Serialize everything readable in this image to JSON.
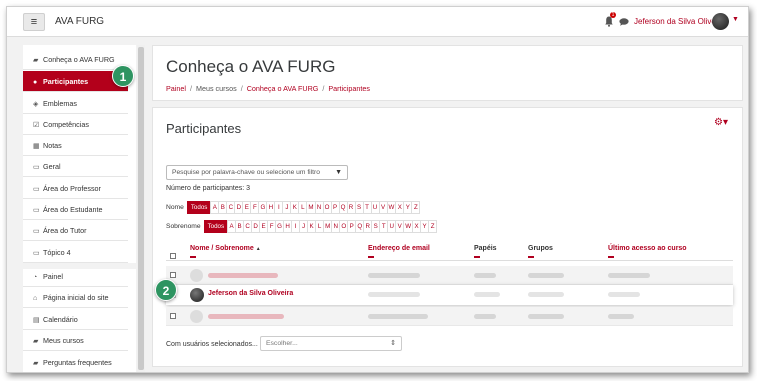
{
  "navbar": {
    "menu_icon": "hamburger-icon",
    "brand": "AVA FURG",
    "notification_icon": "bell-icon",
    "notification_count": "1",
    "messages_icon": "chat-icon",
    "user_name": "Jeferson da Silva Oliveira",
    "user_menu_icon": "caret-down-icon"
  },
  "sidebar": {
    "items": [
      {
        "label": "Conheça o AVA FURG",
        "icon": "graduation-cap-icon",
        "glyph": "🎓"
      },
      {
        "label": "Participantes",
        "icon": "users-icon",
        "glyph": "👥"
      },
      {
        "label": "Emblemas",
        "icon": "shield-icon",
        "glyph": "🛡"
      },
      {
        "label": "Competências",
        "icon": "checkbox-icon",
        "glyph": "☑"
      },
      {
        "label": "Notas",
        "icon": "table-icon",
        "glyph": "▦"
      },
      {
        "label": "Geral",
        "icon": "folder-icon",
        "glyph": "▢"
      },
      {
        "label": "Área do Professor",
        "icon": "folder-icon",
        "glyph": "▢"
      },
      {
        "label": "Área do Estudante",
        "icon": "folder-icon",
        "glyph": "▢"
      },
      {
        "label": "Área do Tutor",
        "icon": "folder-icon",
        "glyph": "▢"
      },
      {
        "label": "Tópico 4",
        "icon": "folder-icon",
        "glyph": "▢"
      }
    ],
    "items2": [
      {
        "label": "Painel",
        "icon": "dashboard-icon",
        "glyph": "◔"
      },
      {
        "label": "Página inicial do site",
        "icon": "home-icon",
        "glyph": "⌂"
      },
      {
        "label": "Calendário",
        "icon": "calendar-icon",
        "glyph": "▤"
      },
      {
        "label": "Meus cursos",
        "icon": "graduation-cap-icon",
        "glyph": "🎓"
      },
      {
        "label": "Perguntas frequentes",
        "icon": "graduation-cap-icon",
        "glyph": "🎓"
      }
    ]
  },
  "header": {
    "title": "Conheça o AVA FURG",
    "breadcrumb": [
      "Painel",
      "Meus cursos",
      "Conheça o AVA FURG",
      "Participantes"
    ]
  },
  "main": {
    "title": "Participantes",
    "settings_icon": "gear-icon",
    "filter_placeholder": "Pesquise por palavra-chave ou selecione um filtro",
    "participant_count": "Número de participantes: 3",
    "first_name_label": "Nome",
    "last_name_label": "Sobrenome",
    "all_label": "Todos",
    "letters": [
      "A",
      "B",
      "C",
      "D",
      "E",
      "F",
      "G",
      "H",
      "I",
      "J",
      "K",
      "L",
      "M",
      "N",
      "O",
      "P",
      "Q",
      "R",
      "S",
      "T",
      "U",
      "V",
      "W",
      "X",
      "Y",
      "Z"
    ],
    "columns": {
      "name": "Nome / Sobrenome",
      "sort_indicator": "▲",
      "email": "Endereço de email",
      "roles": "Papéis",
      "groups": "Grupos",
      "last_access": "Último acesso ao curso"
    },
    "rows": [
      {
        "name": "",
        "highlighted": false
      },
      {
        "name": "Jeferson da Silva Oliveira",
        "highlighted": true
      },
      {
        "name": "",
        "highlighted": false
      }
    ],
    "bulk_label": "Com usuários selecionados...",
    "bulk_placeholder": "Escolher..."
  },
  "annotations": [
    "1",
    "2"
  ],
  "colors": {
    "brand_red": "#b3001b",
    "marker_green": "#2e9461"
  }
}
